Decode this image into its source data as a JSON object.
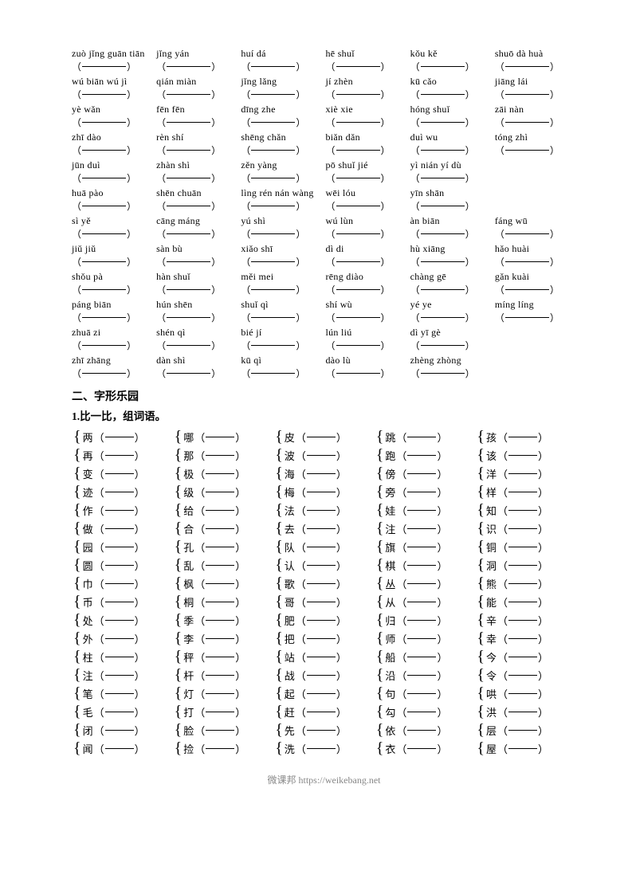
{
  "pinyin_rows": [
    [
      {
        "py": "zuò jǐng guān tiān",
        "blank": true
      },
      {
        "py": "jǐng yán",
        "blank": true
      },
      {
        "py": "huí dá",
        "blank": true
      },
      {
        "py": "hē shuǐ",
        "blank": true
      },
      {
        "py": "kǒu kě",
        "blank": true
      },
      {
        "py": "shuō dà huà",
        "blank": true
      }
    ],
    [
      {
        "py": "wú biān wú jì",
        "blank": true
      },
      {
        "py": "qián miàn",
        "blank": true
      },
      {
        "py": "jǐng lǎng",
        "blank": true
      },
      {
        "py": "jí zhèn",
        "blank": true
      },
      {
        "py": "kū cǎo",
        "blank": true
      },
      {
        "py": "jiāng lái",
        "blank": true
      }
    ],
    [
      {
        "py": "yè wǎn",
        "blank": true
      },
      {
        "py": "fēn fēn",
        "blank": true
      },
      {
        "py": "dīng zhe",
        "blank": true
      },
      {
        "py": "xiè xie",
        "blank": true
      },
      {
        "py": "hóng shuǐ",
        "blank": true
      },
      {
        "py": "zāi nàn",
        "blank": true
      }
    ],
    [
      {
        "py": "zhī dào",
        "blank": true
      },
      {
        "py": "rèn shí",
        "blank": true
      },
      {
        "py": "shēng chǎn",
        "blank": true
      },
      {
        "py": "biǎn dǎn",
        "blank": true
      },
      {
        "py": "duì wu",
        "blank": true
      },
      {
        "py": "tóng zhì",
        "blank": true
      }
    ],
    [
      {
        "py": "jūn duì",
        "blank": true
      },
      {
        "py": "zhàn shì",
        "blank": true
      },
      {
        "py": "zěn yàng",
        "blank": true
      },
      {
        "py": "pō shuǐ jié",
        "blank": true
      },
      {
        "py": "yì nián yí dù",
        "blank": true
      },
      {
        "py": "",
        "blank": false
      }
    ],
    [
      {
        "py": "huā pào",
        "blank": true
      },
      {
        "py": "shēn chuān",
        "blank": true
      },
      {
        "py": "lìng rén nán wàng",
        "blank": true
      },
      {
        "py": "wēi lóu",
        "blank": true
      },
      {
        "py": "yīn shān",
        "blank": true
      },
      {
        "py": "",
        "blank": false
      }
    ],
    [
      {
        "py": "sì yě",
        "blank": true
      },
      {
        "py": "cāng máng",
        "blank": true
      },
      {
        "py": "yú shì",
        "blank": true
      },
      {
        "py": "wú lùn",
        "blank": true
      },
      {
        "py": "àn biān",
        "blank": true
      },
      {
        "py": "fáng wū",
        "blank": true
      }
    ],
    [
      {
        "py": "jiǔ jiǔ",
        "blank": true
      },
      {
        "py": "sàn bù",
        "blank": true
      },
      {
        "py": "xiǎo shī",
        "blank": true
      },
      {
        "py": "dì di",
        "blank": true
      },
      {
        "py": "hù xiāng",
        "blank": true
      },
      {
        "py": "hǎo huài",
        "blank": true
      }
    ],
    [
      {
        "py": "shǒu pà",
        "blank": true
      },
      {
        "py": "hàn shuǐ",
        "blank": true
      },
      {
        "py": "měi mei",
        "blank": true
      },
      {
        "py": "rēng diào",
        "blank": true
      },
      {
        "py": "chàng gē",
        "blank": true
      },
      {
        "py": "gǎn kuài",
        "blank": true
      }
    ],
    [
      {
        "py": "páng biān",
        "blank": true
      },
      {
        "py": "hún shēn",
        "blank": true
      },
      {
        "py": "shuǐ qì",
        "blank": true
      },
      {
        "py": "shí wù",
        "blank": true
      },
      {
        "py": "yé ye",
        "blank": true
      },
      {
        "py": "míng líng",
        "blank": true
      }
    ],
    [
      {
        "py": "zhuā zi",
        "blank": true
      },
      {
        "py": "shén qì",
        "blank": true
      },
      {
        "py": "bié jí",
        "blank": true
      },
      {
        "py": "lún liú",
        "blank": true
      },
      {
        "py": "dì yī gè",
        "blank": true
      },
      {
        "py": "",
        "blank": false
      }
    ],
    [
      {
        "py": "zhī zhāng",
        "blank": true
      },
      {
        "py": "dàn shì",
        "blank": true
      },
      {
        "py": "kū qì",
        "blank": true
      },
      {
        "py": "dào lù",
        "blank": true
      },
      {
        "py": "zhèng zhòng",
        "blank": true
      },
      {
        "py": "",
        "blank": false
      }
    ]
  ],
  "section2_title": "二、字形乐园",
  "section2_sub": "1.比一比，组词语。",
  "char_rows": [
    [
      {
        "left": "两",
        "char": "两",
        "has_bracket": true
      },
      {
        "left": "哪",
        "char": "哪",
        "has_bracket": true
      },
      {
        "left": "皮",
        "char": "皮",
        "has_bracket": true
      },
      {
        "left": "跳",
        "char": "跳",
        "has_bracket": true
      },
      {
        "left": "孩",
        "char": "孩",
        "has_bracket": true
      }
    ],
    [
      {
        "left": "再",
        "char": "再",
        "has_bracket": true
      },
      {
        "left": "那",
        "char": "那",
        "has_bracket": true
      },
      {
        "left": "波",
        "char": "波",
        "has_bracket": true
      },
      {
        "left": "跑",
        "char": "跑",
        "has_bracket": true
      },
      {
        "left": "该",
        "char": "该",
        "has_bracket": true
      }
    ],
    [
      {
        "left": "变",
        "char": "变",
        "has_bracket": true
      },
      {
        "left": "极",
        "char": "极",
        "has_bracket": true
      },
      {
        "left": "海",
        "char": "海",
        "has_bracket": true
      },
      {
        "left": "傍",
        "char": "傍",
        "has_bracket": true
      },
      {
        "left": "洋",
        "char": "洋",
        "has_bracket": true
      }
    ],
    [
      {
        "left": "迹",
        "char": "迹",
        "has_bracket": true
      },
      {
        "left": "级",
        "char": "级",
        "has_bracket": true
      },
      {
        "left": "梅",
        "char": "梅",
        "has_bracket": true
      },
      {
        "left": "旁",
        "char": "旁",
        "has_bracket": true
      },
      {
        "left": "样",
        "char": "样",
        "has_bracket": true
      }
    ],
    [
      {
        "left": "作",
        "char": "作",
        "has_bracket": true
      },
      {
        "left": "给",
        "char": "给",
        "has_bracket": true
      },
      {
        "left": "法",
        "char": "法",
        "has_bracket": true
      },
      {
        "left": "娃",
        "char": "娃",
        "has_bracket": true
      },
      {
        "left": "知",
        "char": "知",
        "has_bracket": true
      }
    ],
    [
      {
        "left": "做",
        "char": "做",
        "has_bracket": true
      },
      {
        "left": "合",
        "char": "合",
        "has_bracket": true
      },
      {
        "left": "去",
        "char": "去",
        "has_bracket": true
      },
      {
        "left": "注",
        "char": "注",
        "has_bracket": true
      },
      {
        "left": "识",
        "char": "识",
        "has_bracket": true
      }
    ],
    [
      {
        "left": "园",
        "char": "园",
        "has_bracket": true
      },
      {
        "left": "孔",
        "char": "孔",
        "has_bracket": true
      },
      {
        "left": "队",
        "char": "队",
        "has_bracket": true
      },
      {
        "left": "旗",
        "char": "旗",
        "has_bracket": true
      },
      {
        "left": "铜",
        "char": "铜",
        "has_bracket": true
      }
    ],
    [
      {
        "left": "圆",
        "char": "圆",
        "has_bracket": true
      },
      {
        "left": "乱",
        "char": "乱",
        "has_bracket": true
      },
      {
        "left": "认",
        "char": "认",
        "has_bracket": true
      },
      {
        "left": "棋",
        "char": "棋",
        "has_bracket": true
      },
      {
        "left": "洞",
        "char": "洞",
        "has_bracket": true
      }
    ],
    [
      {
        "left": "巾",
        "char": "巾",
        "has_bracket": true
      },
      {
        "left": "枫",
        "char": "枫",
        "has_bracket": true
      },
      {
        "left": "歌",
        "char": "歌",
        "has_bracket": true
      },
      {
        "left": "丛",
        "char": "丛",
        "has_bracket": true
      },
      {
        "left": "熊",
        "char": "熊",
        "has_bracket": true
      }
    ],
    [
      {
        "left": "币",
        "char": "币",
        "has_bracket": true
      },
      {
        "left": "桐",
        "char": "桐",
        "has_bracket": true
      },
      {
        "left": "哥",
        "char": "哥",
        "has_bracket": true
      },
      {
        "left": "从",
        "char": "从",
        "has_bracket": true
      },
      {
        "left": "能",
        "char": "能",
        "has_bracket": true
      }
    ],
    [
      {
        "left": "处",
        "char": "处",
        "has_bracket": true
      },
      {
        "left": "季",
        "char": "季",
        "has_bracket": true
      },
      {
        "left": "肥",
        "char": "肥",
        "has_bracket": true
      },
      {
        "left": "归",
        "char": "归",
        "has_bracket": true
      },
      {
        "left": "辛",
        "char": "辛",
        "has_bracket": true
      }
    ],
    [
      {
        "left": "外",
        "char": "外",
        "has_bracket": true
      },
      {
        "left": "李",
        "char": "李",
        "has_bracket": true
      },
      {
        "left": "把",
        "char": "把",
        "has_bracket": true
      },
      {
        "left": "师",
        "char": "师",
        "has_bracket": true
      },
      {
        "left": "幸",
        "char": "幸",
        "has_bracket": true
      }
    ],
    [
      {
        "left": "柱",
        "char": "柱",
        "has_bracket": true
      },
      {
        "left": "秤",
        "char": "秤",
        "has_bracket": true
      },
      {
        "left": "站",
        "char": "站",
        "has_bracket": true
      },
      {
        "left": "船",
        "char": "船",
        "has_bracket": true
      },
      {
        "left": "今",
        "char": "今",
        "has_bracket": true
      }
    ],
    [
      {
        "left": "注",
        "char": "注",
        "has_bracket": true
      },
      {
        "left": "杆",
        "char": "杆",
        "has_bracket": true
      },
      {
        "left": "战",
        "char": "战",
        "has_bracket": true
      },
      {
        "left": "沿",
        "char": "沿",
        "has_bracket": true
      },
      {
        "left": "令",
        "char": "令",
        "has_bracket": true
      }
    ],
    [
      {
        "left": "笔",
        "char": "笔",
        "has_bracket": true
      },
      {
        "left": "灯",
        "char": "灯",
        "has_bracket": true
      },
      {
        "left": "起",
        "char": "起",
        "has_bracket": true
      },
      {
        "left": "句",
        "char": "句",
        "has_bracket": true
      },
      {
        "left": "哄",
        "char": "哄",
        "has_bracket": true
      }
    ],
    [
      {
        "left": "毛",
        "char": "毛",
        "has_bracket": true
      },
      {
        "left": "打",
        "char": "打",
        "has_bracket": true
      },
      {
        "left": "赶",
        "char": "赶",
        "has_bracket": true
      },
      {
        "left": "勾",
        "char": "勾",
        "has_bracket": true
      },
      {
        "left": "洪",
        "char": "洪",
        "has_bracket": true
      }
    ],
    [
      {
        "left": "闭",
        "char": "闭",
        "has_bracket": true
      },
      {
        "left": "脸",
        "char": "脸",
        "has_bracket": true
      },
      {
        "left": "先",
        "char": "先",
        "has_bracket": true
      },
      {
        "left": "依",
        "char": "依",
        "has_bracket": true
      },
      {
        "left": "层",
        "char": "层",
        "has_bracket": true
      }
    ],
    [
      {
        "left": "闻",
        "char": "闻",
        "has_bracket": true
      },
      {
        "left": "捡",
        "char": "捡",
        "has_bracket": true
      },
      {
        "left": "洗",
        "char": "洗",
        "has_bracket": true
      },
      {
        "left": "衣",
        "char": "衣",
        "has_bracket": true
      },
      {
        "left": "屋",
        "char": "屋",
        "has_bracket": true
      }
    ]
  ],
  "footer": "微课邦 https://weikebang.net"
}
